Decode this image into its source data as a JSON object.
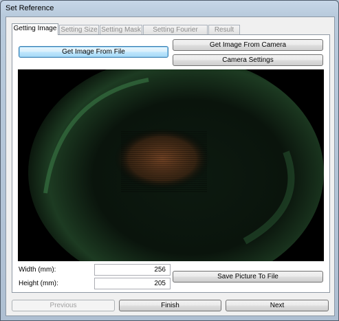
{
  "window": {
    "title": "Set Reference"
  },
  "tabs": [
    {
      "label": "Getting Image",
      "active": true
    },
    {
      "label": "Setting Size",
      "active": false
    },
    {
      "label": "Setting Mask",
      "active": false
    },
    {
      "label": "Setting Fourier Mask",
      "active": false
    },
    {
      "label": "Result",
      "active": false
    }
  ],
  "buttons": {
    "get_image_from_file": "Get Image From File",
    "get_image_from_camera": "Get Image From Camera",
    "camera_settings": "Camera Settings",
    "save_picture": "Save Picture To File"
  },
  "fields": {
    "width_label": "Width (mm):",
    "width_value": "256",
    "height_label": "Height (mm):",
    "height_value": "205"
  },
  "footer": {
    "previous": "Previous",
    "finish": "Finish",
    "next": "Next"
  },
  "colors": {
    "image_background": "#000000",
    "glow_green": "#2f6b3a",
    "spot_orange": "#8a4e2a"
  }
}
